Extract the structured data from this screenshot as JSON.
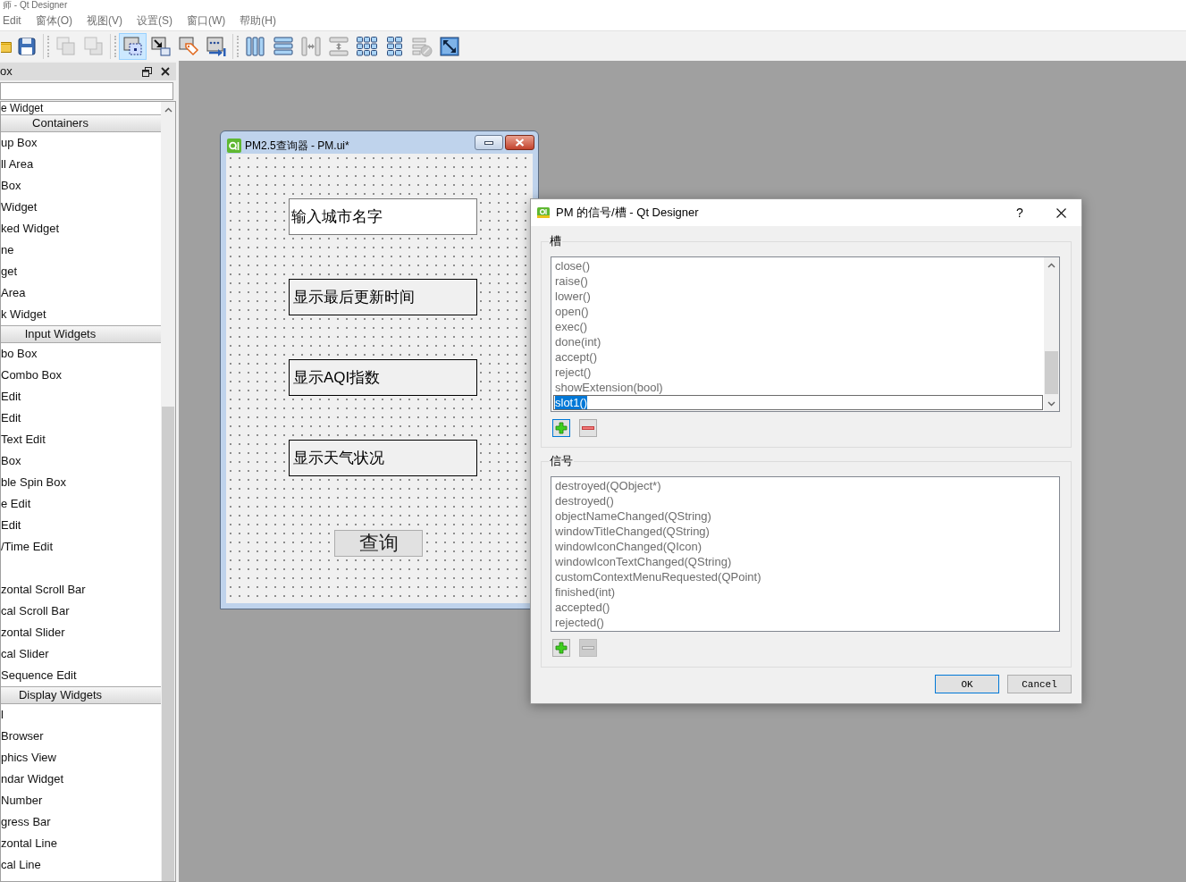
{
  "window": {
    "title": "师 - Qt Designer"
  },
  "menu_bar": [
    {
      "label": "Edit"
    },
    {
      "label": "窗体(O)"
    },
    {
      "label": "视图(V)"
    },
    {
      "label": "设置(S)"
    },
    {
      "label": "窗口(W)"
    },
    {
      "label": "帮助(H)"
    }
  ],
  "toolbar": [
    [
      {
        "selected": false,
        "disabled": false
      },
      {
        "selected": false,
        "disabled": false
      }
    ],
    [
      {
        "selected": false,
        "disabled": true
      },
      {
        "selected": false,
        "disabled": true
      }
    ],
    [
      {
        "selected": true,
        "disabled": false
      },
      {
        "selected": false,
        "disabled": false
      },
      {
        "selected": false,
        "disabled": false
      },
      {
        "selected": false,
        "disabled": false
      }
    ],
    [
      {
        "selected": false,
        "disabled": false
      },
      {
        "selected": false,
        "disabled": false
      },
      {
        "selected": false,
        "disabled": true
      },
      {
        "selected": false,
        "disabled": true
      },
      {
        "selected": false,
        "disabled": false
      },
      {
        "selected": false,
        "disabled": false
      },
      {
        "selected": false,
        "disabled": true
      },
      {
        "selected": false,
        "disabled": false
      }
    ]
  ],
  "widget_box": {
    "title": "ox",
    "items": [
      {
        "kind": "widget",
        "label": "e Widget"
      },
      {
        "kind": "category",
        "label": "Containers"
      },
      {
        "kind": "widget",
        "label": "up Box"
      },
      {
        "kind": "widget",
        "label": "ll Area"
      },
      {
        "kind": "widget",
        "label": "Box"
      },
      {
        "kind": "widget",
        "label": "Widget"
      },
      {
        "kind": "widget",
        "label": "ked Widget"
      },
      {
        "kind": "widget",
        "label": "ne"
      },
      {
        "kind": "widget",
        "label": "get"
      },
      {
        "kind": "widget",
        "label": "Area"
      },
      {
        "kind": "widget",
        "label": "k Widget"
      },
      {
        "kind": "category",
        "label": "Input Widgets"
      },
      {
        "kind": "widget",
        "label": "bo Box"
      },
      {
        "kind": "widget",
        "label": "Combo Box"
      },
      {
        "kind": "widget",
        "label": "Edit"
      },
      {
        "kind": "widget",
        "label": "Edit"
      },
      {
        "kind": "widget",
        "label": "Text Edit"
      },
      {
        "kind": "widget",
        "label": "Box"
      },
      {
        "kind": "widget",
        "label": "ble Spin Box"
      },
      {
        "kind": "widget",
        "label": "e Edit"
      },
      {
        "kind": "widget",
        "label": "Edit"
      },
      {
        "kind": "widget",
        "label": "/Time Edit"
      },
      {
        "kind": "widget"
      },
      {
        "kind": "widget",
        "label": "zontal Scroll Bar"
      },
      {
        "kind": "widget",
        "label": "cal Scroll Bar"
      },
      {
        "kind": "widget",
        "label": "zontal Slider"
      },
      {
        "kind": "widget",
        "label": "cal Slider"
      },
      {
        "kind": "widget",
        "label": "Sequence Edit"
      },
      {
        "kind": "category",
        "label": "Display Widgets"
      },
      {
        "kind": "widget",
        "label": "l"
      },
      {
        "kind": "widget",
        "label": "Browser"
      },
      {
        "kind": "widget",
        "label": "phics View"
      },
      {
        "kind": "widget",
        "label": "ndar Widget"
      },
      {
        "kind": "widget",
        "label": "Number"
      },
      {
        "kind": "widget",
        "label": "gress Bar"
      },
      {
        "kind": "widget",
        "label": "zontal Line"
      },
      {
        "kind": "widget",
        "label": "cal Line"
      }
    ]
  },
  "form_window": {
    "title": "PM2.5查询器 - PM.ui*",
    "widgets": [
      {
        "kind": "line_edit",
        "text": "输入城市名字"
      },
      {
        "kind": "label",
        "text": "显示最后更新时间"
      },
      {
        "kind": "label",
        "text": "显示AQI指数"
      },
      {
        "kind": "label",
        "text": "显示天气状况"
      },
      {
        "kind": "push_button",
        "text": "查询"
      }
    ]
  },
  "dialog": {
    "title": "PM 的信号/槽 - Qt Designer",
    "help_button": "?",
    "slots": {
      "title": "槽",
      "items": [
        {
          "label": "close()",
          "selected": false
        },
        {
          "label": "raise()",
          "selected": false
        },
        {
          "label": "lower()",
          "selected": false
        },
        {
          "label": "open()",
          "selected": false
        },
        {
          "label": "exec()",
          "selected": false
        },
        {
          "label": "done(int)",
          "selected": false
        },
        {
          "label": "accept()",
          "selected": false
        },
        {
          "label": "reject()",
          "selected": false
        },
        {
          "label": "showExtension(bool)",
          "selected": false
        },
        {
          "label": "slot1()",
          "selected": true
        }
      ],
      "add_button": {
        "focused": true
      },
      "remove_button": {
        "disabled": false
      }
    },
    "signals": {
      "title": "信号",
      "items": [
        {
          "label": "destroyed(QObject*)",
          "selected": false
        },
        {
          "label": "destroyed()",
          "selected": false
        },
        {
          "label": "objectNameChanged(QString)",
          "selected": false
        },
        {
          "label": "windowTitleChanged(QString)",
          "selected": false
        },
        {
          "label": "windowIconChanged(QIcon)",
          "selected": false
        },
        {
          "label": "windowIconTextChanged(QString)",
          "selected": false
        },
        {
          "label": "customContextMenuRequested(QPoint)",
          "selected": false
        },
        {
          "label": "finished(int)",
          "selected": false
        },
        {
          "label": "accepted()",
          "selected": false
        },
        {
          "label": "rejected()",
          "selected": false
        }
      ],
      "add_button": {
        "focused": false
      },
      "remove_button": {
        "disabled": true
      }
    },
    "buttons": [
      {
        "label": "OK",
        "default": true
      },
      {
        "label": "Cancel",
        "default": false
      }
    ]
  }
}
